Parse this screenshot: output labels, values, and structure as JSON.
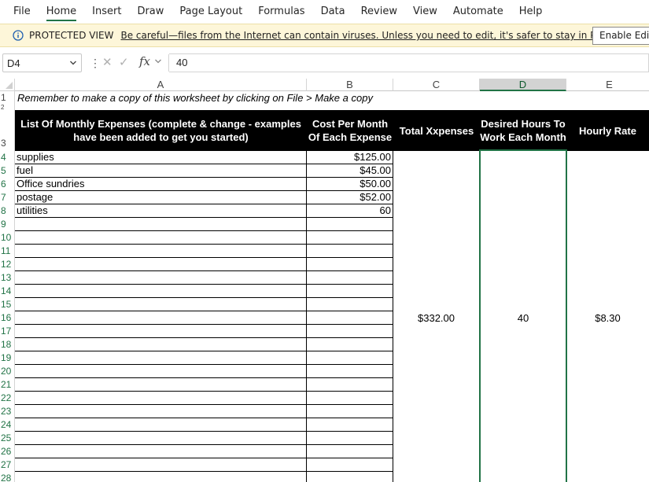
{
  "menu": [
    "File",
    "Home",
    "Insert",
    "Draw",
    "Page Layout",
    "Formulas",
    "Data",
    "Review",
    "View",
    "Automate",
    "Help"
  ],
  "menu_active": "Home",
  "protected_view": {
    "title": "PROTECTED VIEW",
    "message": "Be careful—files from the Internet can contain viruses. Unless you need to edit, it's safer to stay in Protected View.",
    "button": "Enable Editing"
  },
  "formula_bar": {
    "name_box": "D4",
    "fx": "fx",
    "value": "40"
  },
  "columns": [
    "A",
    "B",
    "C",
    "D",
    "E"
  ],
  "selected_column": "D",
  "rows": [
    "1",
    "2",
    "3",
    "4",
    "5",
    "6",
    "7",
    "8",
    "9",
    "10",
    "11",
    "12",
    "13",
    "14",
    "15",
    "16",
    "17",
    "18",
    "19",
    "20",
    "21",
    "22",
    "23",
    "24",
    "25",
    "26",
    "27",
    "28"
  ],
  "sheet": {
    "note": "Remember to make a copy of this worksheet by clicking on File > Make a copy",
    "headers": {
      "a": "List Of Monthly Expenses (complete & change - examples have been added to get you started)",
      "b": "Cost Per Month Of Each Expense",
      "c": "Total Xxpenses",
      "d": "Desired Hours To Work Each Month",
      "e": "Hourly Rate"
    },
    "expenses": [
      {
        "name": "supplies",
        "cost": "$125.00"
      },
      {
        "name": "fuel",
        "cost": "$45.00"
      },
      {
        "name": "Office sundries",
        "cost": "$50.00"
      },
      {
        "name": "postage",
        "cost": "$52.00"
      },
      {
        "name": "utilities",
        "cost": "60"
      }
    ],
    "total": "$332.00",
    "hours": "40",
    "rate": "$8.30"
  }
}
